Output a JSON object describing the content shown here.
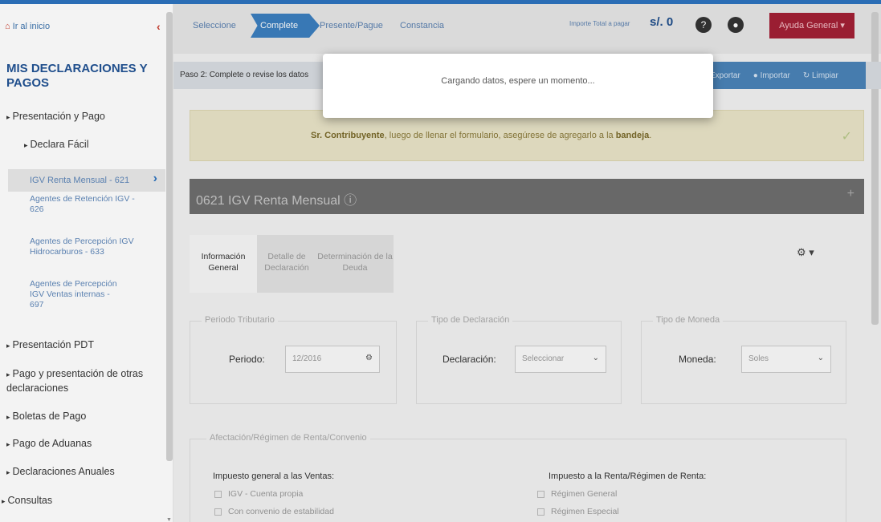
{
  "sidebar": {
    "home": "Ir al inicio",
    "title": "MIS DECLARACIONES Y PAGOS",
    "items": {
      "presentacion_pago": "Presentación y Pago",
      "declara_facil": "Declara Fácil",
      "igv_renta": "IGV Renta Mensual - 621",
      "agentes_retencion": "Agentes de Retención IGV - 626",
      "agentes_percepcion_hidro": "Agentes de Percepción IGV Hidrocarburos - 633",
      "agentes_percepcion_ventas": "Agentes de Percepción IGV Ventas internas - 697",
      "presentacion_pdt": "Presentación PDT",
      "pago_otras": "Pago y presentación de otras declaraciones",
      "boletas": "Boletas de Pago",
      "aduanas": "Pago de Aduanas",
      "anuales": "Declaraciones Anuales",
      "consultas": "Consultas"
    }
  },
  "wizard": {
    "step1": "Seleccione",
    "step2": "Complete",
    "step3": "Presente/Pague",
    "step4": "Constancia"
  },
  "header": {
    "importe_label": "Importe Total a pagar",
    "importe_value": "s/. 0",
    "ayuda": "Ayuda General"
  },
  "step2": {
    "text": "Paso 2: Complete o revise los datos",
    "btn_exportar": "Exportar",
    "btn_importar": "Importar",
    "btn_limpiar": "Limpiar"
  },
  "notice": {
    "bold1": "Sr. Contribuyente",
    "text": ", luego de llenar el formulario, asegúrese de agregarlo a la ",
    "bold2": "bandeja"
  },
  "panel": {
    "title": "0621 IGV Renta Mensual"
  },
  "info_tabs": {
    "t1": "Información General",
    "t2": "Detalle de Declaración",
    "t3": "Determinación de la Deuda"
  },
  "periodo": {
    "legend": "Periodo Tributario",
    "label": "Periodo:",
    "value": "12/2016"
  },
  "declaracion": {
    "legend": "Tipo de Declaración",
    "label": "Declaración:",
    "value": "Seleccionar"
  },
  "moneda": {
    "legend": "Tipo de Moneda",
    "label": "Moneda:",
    "value": "Soles"
  },
  "afectacion": {
    "legend": "Afectación/Régimen de Renta/Convenio",
    "igv_title": "Impuesto general a las Ventas:",
    "igv_opt1": "IGV - Cuenta propia",
    "igv_opt2": "Con convenio de estabilidad",
    "renta_title": "Impuesto a la Renta/Régimen de Renta:",
    "renta_opt1": "Régimen General",
    "renta_opt2": "Régimen Especial"
  },
  "modal": {
    "text": "Cargando datos, espere un momento..."
  }
}
